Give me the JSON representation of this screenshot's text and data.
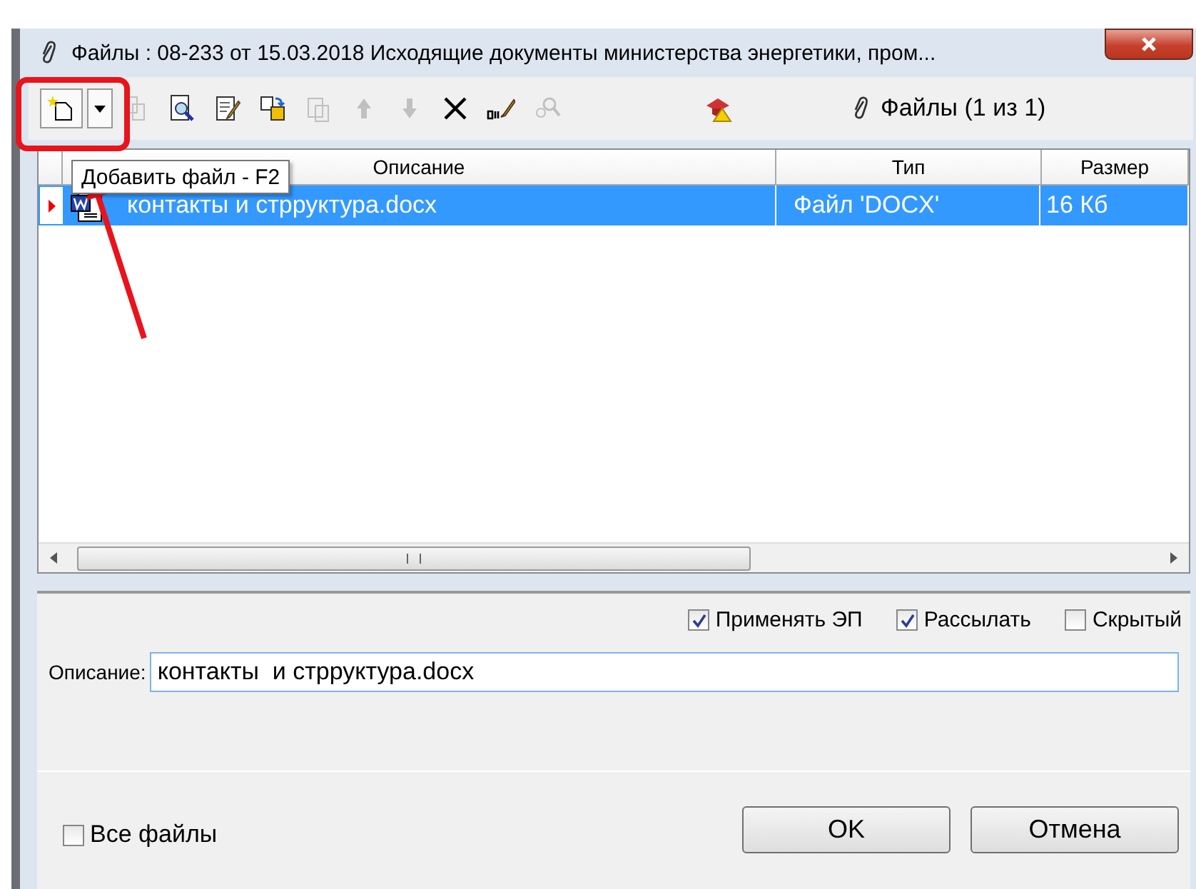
{
  "window": {
    "title": "Файлы : 08-233 от 15.03.2018 Исходящие документы министерства энергетики, пром..."
  },
  "toolbar": {
    "buttons": [
      {
        "kind": "new-file",
        "disabled": false
      },
      {
        "kind": "dropdown",
        "disabled": false
      },
      {
        "kind": "copy",
        "disabled": true
      },
      {
        "kind": "preview",
        "disabled": false
      },
      {
        "kind": "edit",
        "disabled": false
      },
      {
        "kind": "replace",
        "disabled": false
      },
      {
        "kind": "paste",
        "disabled": true
      },
      {
        "kind": "up",
        "disabled": true
      },
      {
        "kind": "down",
        "disabled": true
      },
      {
        "kind": "delete",
        "disabled": false
      },
      {
        "kind": "sign",
        "disabled": false
      },
      {
        "kind": "search",
        "disabled": true
      },
      {
        "kind": "warning",
        "disabled": false
      }
    ],
    "files_counter": "Файлы (1 из 1)"
  },
  "tooltip": "Добавить файл - F2",
  "table": {
    "columns": [
      {
        "label": "Описание"
      },
      {
        "label": "Тип"
      },
      {
        "label": "Размер"
      }
    ],
    "rows": [
      {
        "selected": true,
        "cells": [
          "контакты  и стрруктура.docx",
          "Файл 'DOCX'",
          "16 Кб"
        ]
      }
    ]
  },
  "options": [
    {
      "label": "Применять ЭП",
      "checked": true
    },
    {
      "label": "Рассылать",
      "checked": true
    },
    {
      "label": "Скрытый",
      "checked": false
    }
  ],
  "description": {
    "label": "Описание:",
    "value": "контакты  и стрруктура.docx"
  },
  "all_files": {
    "label": "Все файлы",
    "checked": false
  },
  "buttons": [
    {
      "label": "OK"
    },
    {
      "label": "Отмена"
    }
  ]
}
